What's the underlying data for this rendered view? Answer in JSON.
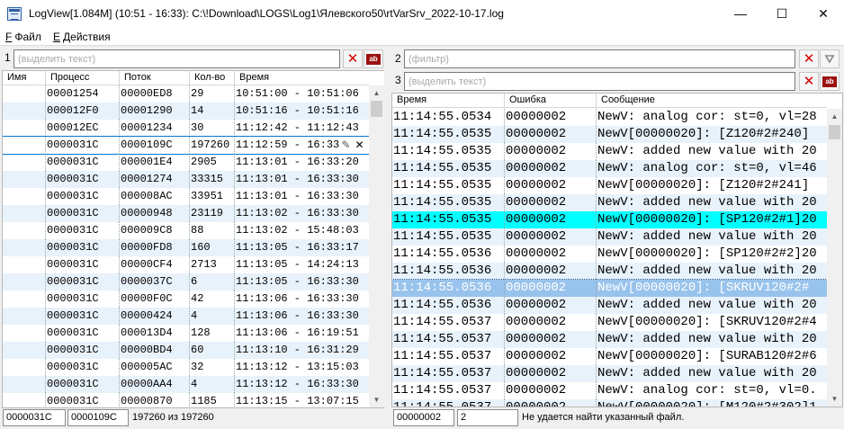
{
  "window": {
    "title": "LogView[1.084M] (10:51 - 16:33): C:\\!Download\\LOGS\\Log1\\Ялевского50\\rtVarSrv_2022-10-17.log",
    "minimize": "—",
    "maximize": "☐",
    "close": "✕"
  },
  "menu": [
    {
      "mnemonic": "F",
      "label": "Файл"
    },
    {
      "mnemonic": "E",
      "label": "Действия"
    }
  ],
  "left_pane": {
    "filter_number": "1",
    "filter_placeholder": "(выделить текст)",
    "columns": [
      "Имя",
      "Процесс",
      "Поток",
      "Кол-во",
      "Время"
    ],
    "rows": [
      [
        "",
        "00001254",
        "00000ED8",
        "29",
        "10:51:00 - 10:51:06"
      ],
      [
        "",
        "000012F0",
        "00001290",
        "14",
        "10:51:16 - 10:51:16"
      ],
      [
        "",
        "000012EC",
        "00001234",
        "30",
        "11:12:42 - 11:12:43"
      ],
      [
        "",
        "0000031C",
        "0000109C",
        "197260",
        "11:12:59 - 16:33"
      ],
      [
        "",
        "0000031C",
        "000001E4",
        "2905",
        "11:13:01 - 16:33:20"
      ],
      [
        "",
        "0000031C",
        "00001274",
        "33315",
        "11:13:01 - 16:33:30"
      ],
      [
        "",
        "0000031C",
        "000008AC",
        "33951",
        "11:13:01 - 16:33:30"
      ],
      [
        "",
        "0000031C",
        "00000948",
        "23119",
        "11:13:02 - 16:33:30"
      ],
      [
        "",
        "0000031C",
        "000009C8",
        "88",
        "11:13:02 - 15:48:03"
      ],
      [
        "",
        "0000031C",
        "00000FD8",
        "160",
        "11:13:05 - 16:33:17"
      ],
      [
        "",
        "0000031C",
        "00000CF4",
        "2713",
        "11:13:05 - 14:24:13"
      ],
      [
        "",
        "0000031C",
        "0000037C",
        "6",
        "11:13:05 - 16:33:30"
      ],
      [
        "",
        "0000031C",
        "00000F0C",
        "42",
        "11:13:06 - 16:33:30"
      ],
      [
        "",
        "0000031C",
        "00000424",
        "4",
        "11:13:06 - 16:33:30"
      ],
      [
        "",
        "0000031C",
        "000013D4",
        "128",
        "11:13:06 - 16:19:51"
      ],
      [
        "",
        "0000031C",
        "00000BD4",
        "60",
        "11:13:10 - 16:31:29"
      ],
      [
        "",
        "0000031C",
        "000005AC",
        "32",
        "11:13:12 - 13:15:03"
      ],
      [
        "",
        "0000031C",
        "00000AA4",
        "4",
        "11:13:12 - 16:33:30"
      ],
      [
        "",
        "0000031C",
        "00000870",
        "1185",
        "11:13:15 - 13:07:15"
      ]
    ],
    "edit_pencil_icon": "✎",
    "edit_cancel_icon": "✕",
    "status": {
      "process": "0000031C",
      "thread": "0000109C",
      "count": "197260 из 197260"
    }
  },
  "right_pane": {
    "filter2_number": "2",
    "filter2_placeholder": "(фильтр)",
    "filter3_number": "3",
    "filter3_placeholder": "(выделить текст)",
    "columns": [
      "Время",
      "Ошибка",
      "Сообщение"
    ],
    "rows": [
      [
        "11:14:55.0534",
        "00000002",
        "NewV: analog cor: st=0, vl=28"
      ],
      [
        "11:14:55.0535",
        "00000002",
        "NewV[00000020]: [Z120#2#240]"
      ],
      [
        "11:14:55.0535",
        "00000002",
        "NewV: added new value with 20"
      ],
      [
        "11:14:55.0535",
        "00000002",
        "NewV: analog cor: st=0, vl=46"
      ],
      [
        "11:14:55.0535",
        "00000002",
        "NewV[00000020]: [Z120#2#241]"
      ],
      [
        "11:14:55.0535",
        "00000002",
        "NewV: added new value with 20"
      ],
      [
        "11:14:55.0535",
        "00000002",
        "NewV[00000020]: [SP120#2#1]20"
      ],
      [
        "11:14:55.0535",
        "00000002",
        "NewV: added new value with 20"
      ],
      [
        "11:14:55.0536",
        "00000002",
        "NewV[00000020]: [SP120#2#2]20"
      ],
      [
        "11:14:55.0536",
        "00000002",
        "NewV: added new value with 20"
      ],
      [
        "11:14:55.0536",
        "00000002",
        "NewV[00000020]: [SKRUV120#2#"
      ],
      [
        "11:14:55.0536",
        "00000002",
        "NewV: added new value with 20"
      ],
      [
        "11:14:55.0537",
        "00000002",
        "NewV[00000020]: [SKRUV120#2#4"
      ],
      [
        "11:14:55.0537",
        "00000002",
        "NewV: added new value with 20"
      ],
      [
        "11:14:55.0537",
        "00000002",
        "NewV[00000020]: [SURAB120#2#6"
      ],
      [
        "11:14:55.0537",
        "00000002",
        "NewV: added new value with 20"
      ],
      [
        "11:14:55.0537",
        "00000002",
        "NewV: analog cor: st=0, vl=0."
      ],
      [
        "11:14:55.0537",
        "00000002",
        "NewV[00000020]: [M120#2#302]1"
      ]
    ],
    "status": {
      "error": "00000002",
      "count": "2",
      "message": "Не удается найти указанный файл."
    }
  },
  "icons": {
    "clear": "✕",
    "mark": "ab",
    "filter": "⛛",
    "up": "▲",
    "down": "▼"
  },
  "colors": {
    "alt_row": "#e8f2fb",
    "highlight_row": "#00ffff",
    "selected_row": "#98c3ec",
    "clear_icon": "#d60000"
  }
}
